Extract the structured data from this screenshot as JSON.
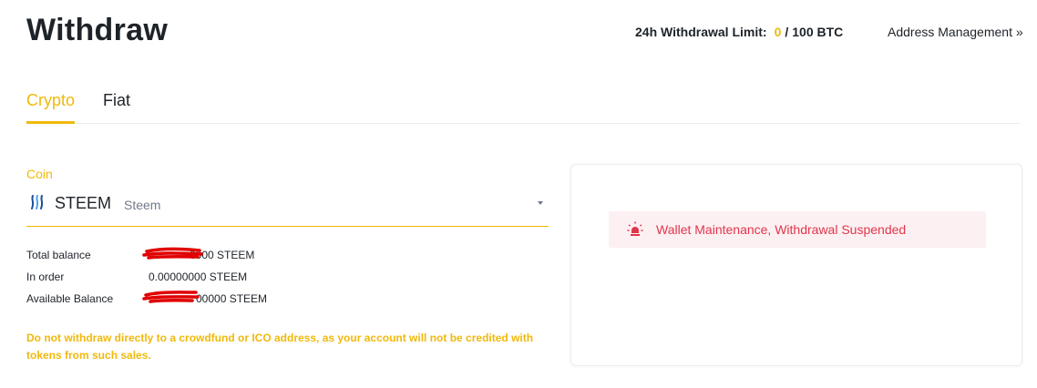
{
  "header": {
    "title": "Withdraw",
    "limit_label": "24h Withdrawal Limit:",
    "limit_used": "0",
    "limit_sep": "/",
    "limit_total": "100 BTC",
    "address_link": "Address Management »"
  },
  "tabs": [
    {
      "label": "Crypto",
      "active": true
    },
    {
      "label": "Fiat",
      "active": false
    }
  ],
  "coin": {
    "label": "Coin",
    "symbol": "STEEM",
    "name": "Steem",
    "icon": "steem-logo-icon"
  },
  "balances": {
    "total_label": "Total balance",
    "total_value": "0000 STEEM",
    "in_order_label": "In order",
    "in_order_value": "0.00000000 STEEM",
    "available_label": "Available Balance",
    "available_value": "00000 STEEM"
  },
  "warning": "Do not withdraw directly to a crowdfund or ICO address, as your account will not be credited with tokens from such sales.",
  "notice": {
    "icon": "bulb-icon",
    "text": "Wallet Maintenance, Withdrawal Suspended"
  },
  "colors": {
    "accent": "#f0b90b",
    "text": "#1e2329",
    "muted": "#707a8a",
    "error": "#e1354b",
    "error_bg": "#fdf0f2",
    "redaction": "#e00000"
  }
}
